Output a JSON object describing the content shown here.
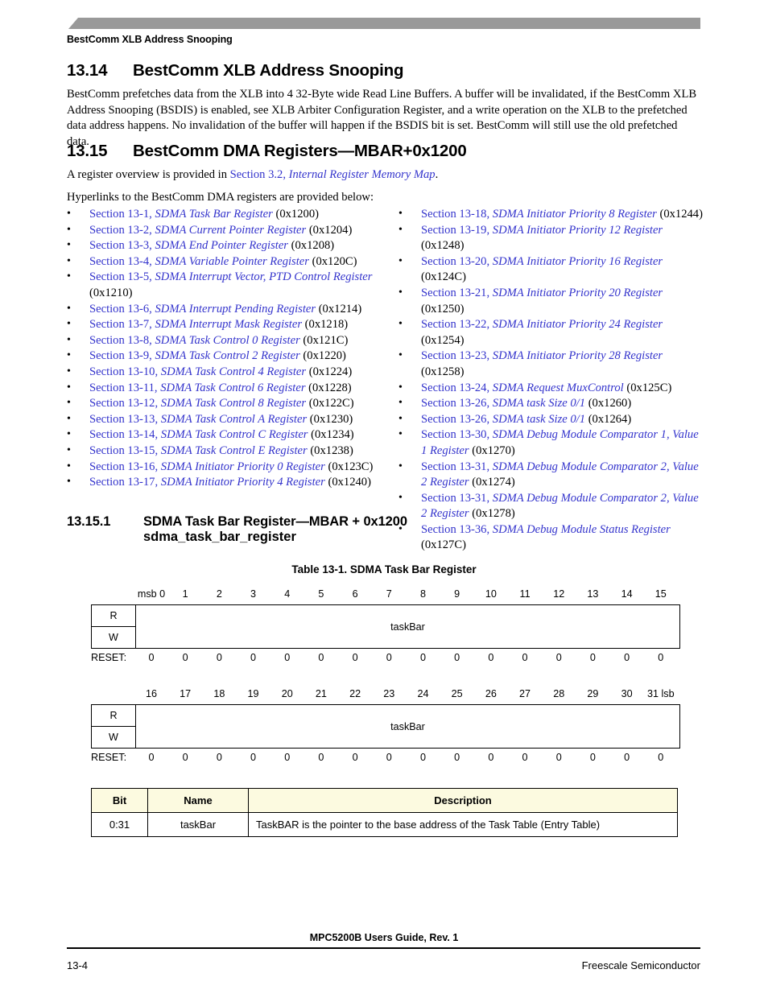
{
  "page": {
    "running_head": "BestComm XLB Address Snooping",
    "footer_title": "MPC5200B Users Guide, Rev. 1",
    "footer_page": "13-4",
    "footer_company": "Freescale Semiconductor",
    "link_color": "#3333cc",
    "header_bar_color": "#999999",
    "table_header_bg": "#fcfae0"
  },
  "section_1314": {
    "number": "13.14",
    "title": "BestComm XLB Address Snooping",
    "paragraph": "BestComm prefetches data from the XLB into 4 32-Byte wide Read Line Buffers. A buffer will be invalidated, if the BestComm XLB Address Snooping (BSDIS) is enabled, see XLB Arbiter Configuration Register, and a write operation on the XLB to the prefetched data address happens. No invalidation of the buffer will happen if the BSDIS bit is set. BestComm will still use the old prefetched data."
  },
  "section_1315": {
    "number": "13.15",
    "title": "BestComm DMA Registers—MBAR+0x1200",
    "overview_prefix": "A register overview is provided in ",
    "overview_link_plain": "Section 3.2, ",
    "overview_link_italic": "Internal Register Memory Map",
    "overview_suffix": ".",
    "hyperlinks_intro": "Hyperlinks to the BestComm DMA registers are provided below:",
    "bullet": "•"
  },
  "links_left": [
    {
      "sec": "Section 13-1, ",
      "name": "SDMA Task Bar Register",
      "addr": " (0x1200)"
    },
    {
      "sec": "Section 13-2, ",
      "name": "SDMA Current Pointer Register",
      "addr": " (0x1204)"
    },
    {
      "sec": "Section 13-3, ",
      "name": "SDMA End Pointer Register",
      "addr": " (0x1208)"
    },
    {
      "sec": "Section 13-4, ",
      "name": "SDMA Variable Pointer Register",
      "addr": " (0x120C)"
    },
    {
      "sec": "Section 13-5, ",
      "name": "SDMA Interrupt Vector, PTD Control Register",
      "addr": " (0x1210)"
    },
    {
      "sec": "Section 13-6, ",
      "name": "SDMA Interrupt Pending Register",
      "addr": " (0x1214)"
    },
    {
      "sec": "Section 13-7, ",
      "name": "SDMA Interrupt Mask Register",
      "addr": " (0x1218)"
    },
    {
      "sec": "Section 13-8, ",
      "name": "SDMA Task Control 0 Register",
      "addr": " (0x121C)"
    },
    {
      "sec": "Section 13-9, ",
      "name": "SDMA Task Control 2 Register",
      "addr": " (0x1220)"
    },
    {
      "sec": "Section 13-10, ",
      "name": "SDMA Task Control 4 Register",
      "addr": " (0x1224)"
    },
    {
      "sec": "Section 13-11, ",
      "name": "SDMA Task Control 6 Register",
      "addr": " (0x1228)"
    },
    {
      "sec": "Section 13-12, ",
      "name": "SDMA Task Control 8 Register",
      "addr": " (0x122C)"
    },
    {
      "sec": "Section 13-13, ",
      "name": "SDMA Task Control A Register",
      "addr": " (0x1230)"
    },
    {
      "sec": "Section 13-14, ",
      "name": "SDMA Task Control C Register",
      "addr": " (0x1234)"
    },
    {
      "sec": "Section 13-15, ",
      "name": "SDMA Task Control E Register",
      "addr": " (0x1238)"
    },
    {
      "sec": "Section 13-16, ",
      "name": "SDMA Initiator Priority 0 Register",
      "addr": " (0x123C)"
    },
    {
      "sec": "Section 13-17, ",
      "name": "SDMA Initiator Priority 4 Register",
      "addr": " (0x1240)"
    }
  ],
  "links_right": [
    {
      "sec": "Section 13-18, ",
      "name": "SDMA Initiator Priority 8 Register",
      "addr": " (0x1244)"
    },
    {
      "sec": "Section 13-19, ",
      "name": "SDMA Initiator Priority 12 Register",
      "addr": " (0x1248)"
    },
    {
      "sec": "Section 13-20, ",
      "name": "SDMA Initiator Priority 16 Register",
      "addr": " (0x124C)"
    },
    {
      "sec": "Section 13-21, ",
      "name": "SDMA Initiator Priority 20 Register",
      "addr": " (0x1250)"
    },
    {
      "sec": "Section 13-22, ",
      "name": "SDMA Initiator Priority 24 Register",
      "addr": " (0x1254)"
    },
    {
      "sec": "Section 13-23, ",
      "name": "SDMA Initiator Priority 28 Register",
      "addr": " (0x1258)"
    },
    {
      "sec": "Section 13-24, ",
      "name": "SDMA Request MuxControl",
      "addr": " (0x125C)"
    },
    {
      "sec": "Section 13-26, ",
      "name": "SDMA task Size 0/1",
      "addr": " (0x1260)"
    },
    {
      "sec": "Section 13-26, ",
      "name": "SDMA task Size 0/1",
      "addr": " (0x1264)"
    },
    {
      "sec": "Section 13-30, ",
      "name": "SDMA Debug Module Comparator 1, Value 1 Register",
      "addr": " (0x1270)"
    },
    {
      "sec": "Section 13-31, ",
      "name": "SDMA Debug Module Comparator 2, Value 2 Register",
      "addr": " (0x1274)"
    },
    {
      "sec": "Section 13-31, ",
      "name": "SDMA Debug Module Comparator 2, Value 2 Register",
      "addr": " (0x1278)"
    },
    {
      "sec": "Section 13-36, ",
      "name": "SDMA Debug Module Status Register",
      "addr": " (0x127C)"
    }
  ],
  "section_13151": {
    "number": "13.15.1",
    "title": "SDMA Task Bar Register—MBAR + 0x1200",
    "subtitle": "sdma_task_bar_register",
    "table_caption": "Table 13-1. SDMA Task Bar Register"
  },
  "register": {
    "row1": {
      "bit_labels": [
        "msb 0",
        "1",
        "2",
        "3",
        "4",
        "5",
        "6",
        "7",
        "8",
        "9",
        "10",
        "11",
        "12",
        "13",
        "14",
        "15"
      ],
      "read_label": "R",
      "write_label": "W",
      "field_name": "taskBar",
      "reset_label": "RESET:",
      "reset_values": [
        "0",
        "0",
        "0",
        "0",
        "0",
        "0",
        "0",
        "0",
        "0",
        "0",
        "0",
        "0",
        "0",
        "0",
        "0",
        "0"
      ]
    },
    "row2": {
      "bit_labels": [
        "16",
        "17",
        "18",
        "19",
        "20",
        "21",
        "22",
        "23",
        "24",
        "25",
        "26",
        "27",
        "28",
        "29",
        "30",
        "31 lsb"
      ],
      "read_label": "R",
      "write_label": "W",
      "field_name": "taskBar",
      "reset_label": "RESET:",
      "reset_values": [
        "0",
        "0",
        "0",
        "0",
        "0",
        "0",
        "0",
        "0",
        "0",
        "0",
        "0",
        "0",
        "0",
        "0",
        "0",
        "0"
      ]
    }
  },
  "bit_table": {
    "headers": [
      "Bit",
      "Name",
      "Description"
    ],
    "rows": [
      {
        "bit": "0:31",
        "name": "taskBar",
        "description": "TaskBAR is the pointer to the base address of the Task Table (Entry Table)"
      }
    ]
  }
}
